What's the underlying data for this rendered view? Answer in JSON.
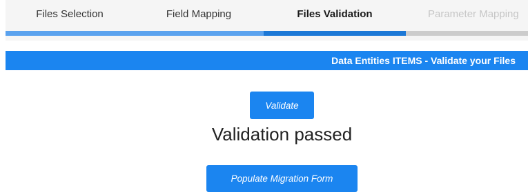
{
  "wizard": {
    "steps": [
      {
        "label": "Files Selection",
        "state": "complete",
        "bar_color": "#5aa2ee"
      },
      {
        "label": "Field Mapping",
        "state": "complete",
        "bar_color": "#5aa2ee"
      },
      {
        "label": "Files Validation",
        "state": "active",
        "bar_color": "#1c78d6"
      },
      {
        "label": "Parameter Mapping",
        "state": "disabled",
        "bar_color": "#cccccc"
      }
    ]
  },
  "banner": {
    "text": "Data Entities ITEMS - Validate your Files"
  },
  "actions": {
    "validate_label": "Validate",
    "populate_label": "Populate Migration Form"
  },
  "status": {
    "message": "Validation passed"
  },
  "colors": {
    "primary": "#1b85f0"
  }
}
